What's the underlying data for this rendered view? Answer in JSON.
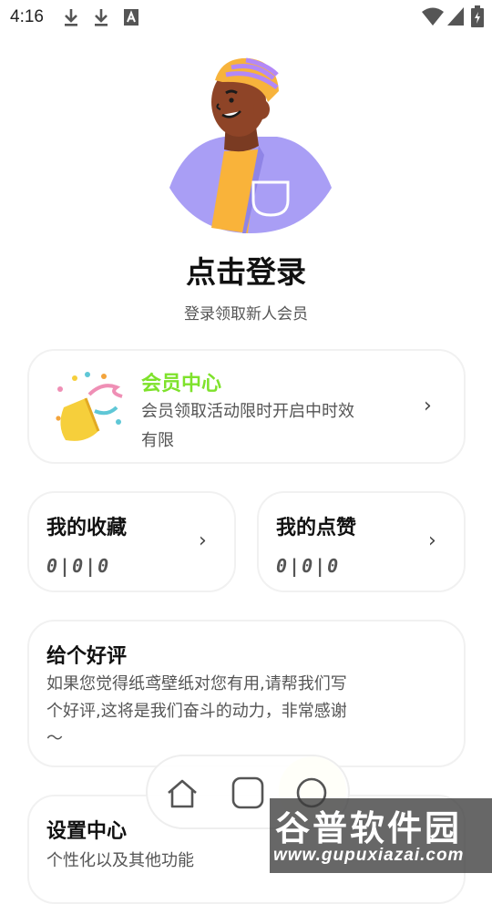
{
  "status_bar": {
    "time": "4:16",
    "icons": [
      "download-icon",
      "download-icon",
      "font-a-icon",
      "wifi-icon",
      "signal-icon",
      "battery-icon"
    ]
  },
  "profile": {
    "avatar": "avatar-illustration",
    "login_title": "点击登录",
    "login_subtitle": "登录领取新人会员"
  },
  "vip_card": {
    "title": "会员中心",
    "description": "会员领取活动限时开启中时效有限",
    "icon": "party-popper-icon",
    "accent_color": "#7ee22b"
  },
  "favorites_card": {
    "title": "我的收藏",
    "count": "0|0|0"
  },
  "likes_card": {
    "title": "我的点赞",
    "count": "0|0|0"
  },
  "review_card": {
    "title": "给个好评",
    "description": "如果您觉得纸鸢壁纸对您有用,请帮我们写个好评,这将是我们奋斗的动力，非常感谢～"
  },
  "settings_card": {
    "title": "设置中心",
    "description": "个性化以及其他功能"
  },
  "nav_bar": {
    "items": [
      "home-icon",
      "square-icon",
      "circle-icon"
    ]
  },
  "watermark": {
    "text": "谷普软件园",
    "url": "www.gupuxiazai.com"
  }
}
